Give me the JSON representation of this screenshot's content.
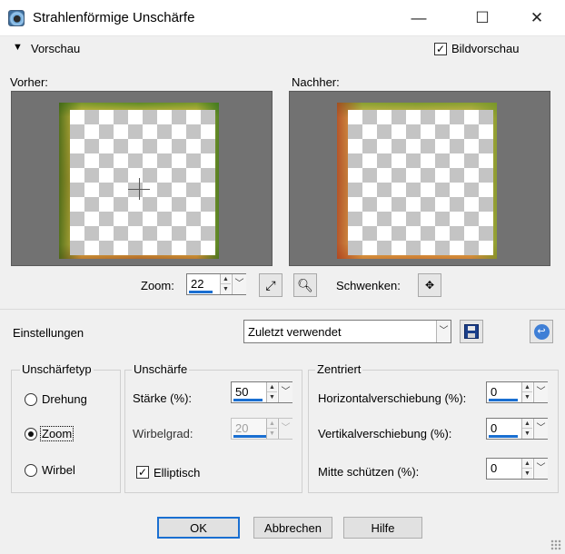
{
  "window": {
    "title": "Strahlenförmige Unschärfe",
    "minimize": "—",
    "maximize": "☐",
    "close": "✕"
  },
  "preview": {
    "section_label": "Vorschau",
    "bildvorschau_label": "Bildvorschau",
    "bildvorschau_checked": true,
    "vorher_label": "Vorher:",
    "nachher_label": "Nachher:",
    "zoom_label": "Zoom:",
    "zoom_value": "22",
    "schwenken_label": "Schwenken:"
  },
  "settings": {
    "label": "Einstellungen",
    "preset_value": "Zuletzt verwendet"
  },
  "unschaerfetyp": {
    "title": "Unschärfetyp",
    "options": [
      {
        "label": "Drehung",
        "selected": false
      },
      {
        "label": "Zoom",
        "selected": true
      },
      {
        "label": "Wirbel",
        "selected": false
      }
    ]
  },
  "unschaerfe": {
    "title": "Unschärfe",
    "staerke_label": "Stärke (%):",
    "staerke_value": "50",
    "wirbelgrad_label": "Wirbelgrad:",
    "wirbelgrad_value": "20",
    "elliptisch_label": "Elliptisch",
    "elliptisch_checked": true
  },
  "zentriert": {
    "title": "Zentriert",
    "horizontal_label": "Horizontalverschiebung (%):",
    "horizontal_value": "0",
    "vertikal_label": "Vertikalverschiebung (%):",
    "vertikal_value": "0",
    "mitte_label": "Mitte schützen (%):",
    "mitte_value": "0"
  },
  "buttons": {
    "ok": "OK",
    "cancel": "Abbrechen",
    "help": "Hilfe"
  },
  "colors": {
    "accent": "#1a6fd1",
    "panel_bg": "#727272",
    "dialog_bg": "#f0f0f0"
  }
}
